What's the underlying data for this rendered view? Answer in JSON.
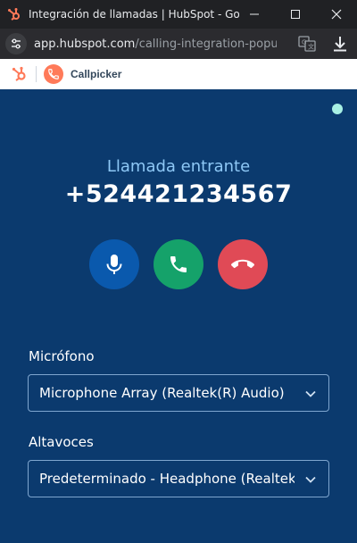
{
  "browser": {
    "tab_title": "Integración de llamadas | HubSpot - Googl...",
    "url_host": "app.hubspot.com",
    "url_path": "/calling-integration-popup..."
  },
  "header": {
    "app_name": "Callpicker"
  },
  "call": {
    "status": "Llamada entrante",
    "number": "+524421234567"
  },
  "devices": {
    "microphone_label": "Micrófono",
    "microphone_value": "Microphone Array (Realtek(R) Audio)",
    "speakers_label": "Altavoces",
    "speakers_value": "Predeterminado - Headphone (Realtek(R) Audio)"
  },
  "colors": {
    "background": "#0b3a6e",
    "mic_button": "#0a59ad",
    "answer_button": "#15a26a",
    "hangup_button": "#e04a56",
    "status_dot": "#a8f0e4",
    "brand_orange": "#ff7a59"
  }
}
